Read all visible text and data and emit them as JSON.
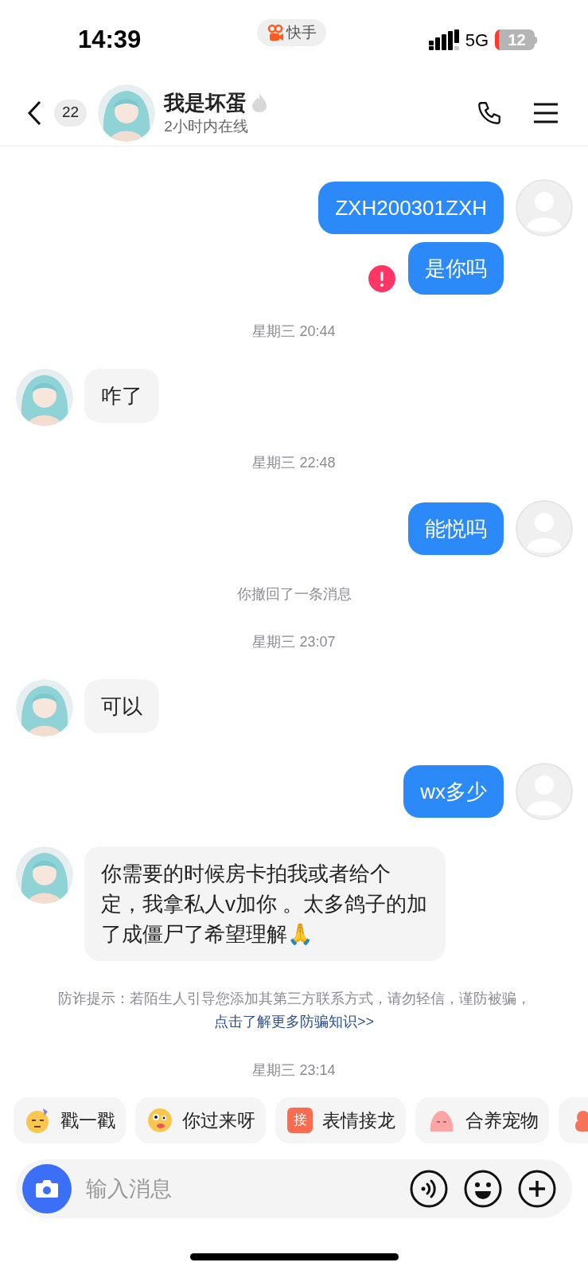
{
  "status_bar": {
    "time": "14:39",
    "app_pill": "快手",
    "network": "5G",
    "battery": "12"
  },
  "header": {
    "unread": "22",
    "name": "我是坏蛋",
    "presence": "2小时内在线"
  },
  "messages": [
    {
      "kind": "out",
      "text": "ZXH200301ZXH",
      "failed": false,
      "show_avatar": true
    },
    {
      "kind": "out",
      "text": "是你吗",
      "failed": true,
      "show_avatar": false
    },
    {
      "kind": "time",
      "text": "星期三 20:44"
    },
    {
      "kind": "in",
      "text": "咋了"
    },
    {
      "kind": "time",
      "text": "星期三 22:48"
    },
    {
      "kind": "out",
      "text": "能悦吗",
      "failed": false,
      "show_avatar": true
    },
    {
      "kind": "notice",
      "text": "你撤回了一条消息"
    },
    {
      "kind": "time",
      "text": "星期三 23:07"
    },
    {
      "kind": "in",
      "text": "可以"
    },
    {
      "kind": "out",
      "text": "wx多少",
      "failed": false,
      "show_avatar": true
    },
    {
      "kind": "in",
      "text": "你需要的时候房卡拍我或者给个定，我拿私人v加你 。太多鸽子的加了成僵尸了希望理解🙏"
    },
    {
      "kind": "warning",
      "text": "防诈提示：若陌生人引导您添加其第三方联系方式，请勿轻信，谨防被骗，",
      "link": "点击了解更多防骗知识>>"
    },
    {
      "kind": "time",
      "text": "星期三 23:14"
    }
  ],
  "quick_actions": [
    {
      "kind": "poke",
      "label": "戳一戳"
    },
    {
      "kind": "wink",
      "label": "你过来呀"
    },
    {
      "kind": "relay",
      "label": "表情接龙",
      "badge": "接"
    },
    {
      "kind": "pet",
      "label": "合养宠物"
    },
    {
      "kind": "more"
    }
  ],
  "composer": {
    "placeholder": "输入消息"
  }
}
